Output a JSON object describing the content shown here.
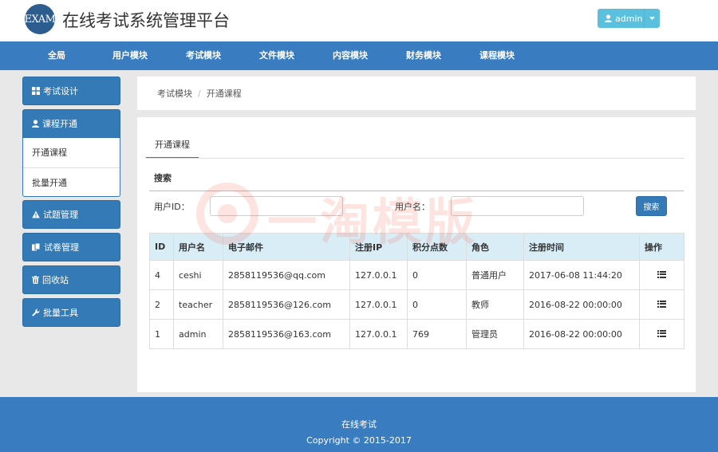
{
  "header": {
    "logo_text": "EXAM",
    "title": "在线考试系统管理平台",
    "user": "admin",
    "user_icon": "user-icon",
    "caret_icon": "caret-down-icon"
  },
  "nav": {
    "items": [
      "全局",
      "用户模块",
      "考试模块",
      "文件模块",
      "内容模块",
      "财务模块",
      "课程模块"
    ],
    "active": "考试模块"
  },
  "sidebar": {
    "items": [
      {
        "label": "考试设计",
        "icon": "grid-icon"
      },
      {
        "label": "课程开通",
        "icon": "user-icon",
        "expanded": true
      },
      {
        "label": "试题管理",
        "icon": "warning-icon"
      },
      {
        "label": "试卷管理",
        "icon": "copy-icon"
      },
      {
        "label": "回收站",
        "icon": "trash-icon"
      },
      {
        "label": "批量工具",
        "icon": "wrench-icon"
      }
    ],
    "sub_items": [
      "开通课程",
      "批量开通"
    ]
  },
  "breadcrumb": {
    "items": [
      "考试模块",
      "开通课程"
    ],
    "separator": "/"
  },
  "main": {
    "tab": "开通课程",
    "search_title": "搜索",
    "fields": [
      {
        "label": "用户ID：",
        "value": ""
      },
      {
        "label": "用户名：",
        "value": ""
      }
    ],
    "search_button": "搜索"
  },
  "watermark": "一淘模版",
  "table": {
    "columns": [
      "ID",
      "用户名",
      "电子邮件",
      "注册IP",
      "积分点数",
      "角色",
      "注册时间",
      "操作"
    ],
    "rows": [
      [
        "4",
        "ceshi",
        "2858119536@qq.com",
        "127.0.0.1",
        "0",
        "普通用户",
        "2017-06-08 11:44:20"
      ],
      [
        "2",
        "teacher",
        "2858119536@126.com",
        "127.0.0.1",
        "0",
        "教师",
        "2016-08-22 00:00:00"
      ],
      [
        "1",
        "admin",
        "2858119536@163.com",
        "127.0.0.1",
        "769",
        "管理员",
        "2016-08-22 00:00:00"
      ]
    ],
    "action_icon": "list-icon"
  },
  "footer": {
    "line1": "在线考试",
    "line2": "Copyright © 2015-2017"
  },
  "colors": {
    "primary": "#337ab7",
    "navbar": "#3a7cc0",
    "info": "#5bc0de",
    "table_header": "#d9edf7",
    "background": "#e8e8e8"
  }
}
